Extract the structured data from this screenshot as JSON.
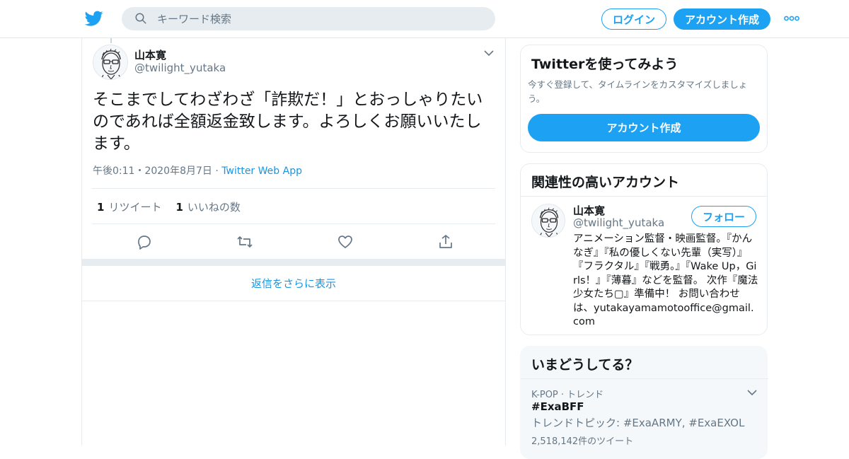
{
  "header": {
    "search_placeholder": "キーワード検索",
    "login_label": "ログイン",
    "signup_label": "アカウント作成"
  },
  "tweet": {
    "author_name": "山本寛",
    "author_handle": "@twilight_yutaka",
    "text": "そこまでしてわざわざ「詐欺だ！」とおっしゃりたいのであれば全額返金致します。よろしくお願いいたします。",
    "time": "午後0:11",
    "date_sep": "・",
    "date": "2020年8月7日",
    "app": "Twitter Web App",
    "retweet_count": "1",
    "retweet_label": "リツイート",
    "like_count": "1",
    "like_label": "いいねの数",
    "more_replies_label": "返信をさらに表示"
  },
  "sidebar": {
    "signup_card": {
      "title": "Twitterを使ってみよう",
      "subtitle": "今すぐ登録して、タイムラインをカスタマイズしましょう。",
      "button_label": "アカウント作成"
    },
    "related_card": {
      "title": "関連性の高いアカウント",
      "account_name": "山本寛",
      "account_handle": "@twilight_yutaka",
      "follow_label": "フォロー",
      "bio": "アニメーション監督・映画監督。『かんなぎ』『私の優しくない先輩（実写）』『フラクタル』『戦勇。』『Wake Up，Girls！』『薄暮』などを監督。 次作『魔法少女たち▢』準備中！ お問い合わせは、yutakayamamotooffice@gmail.com"
    },
    "trends_card": {
      "title": "いまどうしてる？",
      "trend_meta": "K-POP · トレンド",
      "trend_tag": "#ExaBFF",
      "trend_topics": "トレンドトピック: #ExaARMY, #ExaEXOL",
      "trend_count": "2,518,142件のツイート"
    }
  },
  "colors": {
    "brand": "#1da1f2",
    "link": "#1b95e0",
    "secondary_text": "#657786",
    "divider": "#e6ecf0"
  }
}
